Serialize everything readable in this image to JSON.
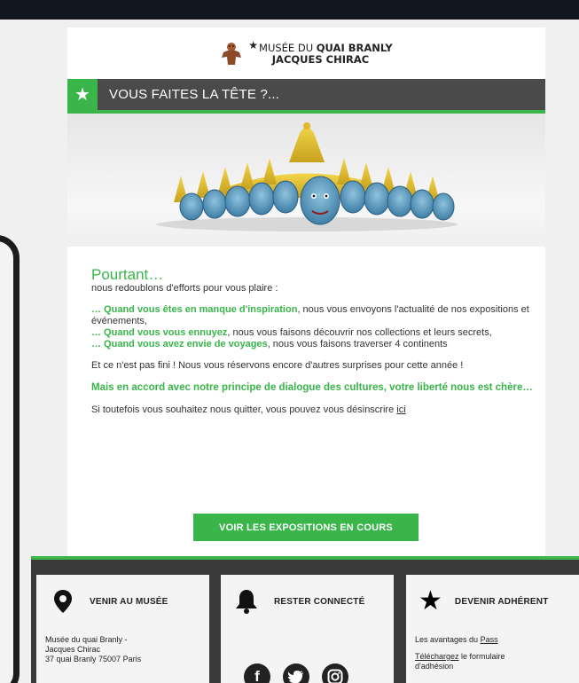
{
  "logo": {
    "star": "★",
    "line1_prefix": "MUSÉE DU",
    "line1_bold": "QUAI BRANLY",
    "line2": "JACQUES CHIRAC"
  },
  "banner": {
    "star": "★",
    "title": "VOUS FAITES LA TÊTE ?..."
  },
  "content": {
    "heading": "Pourtant…",
    "intro": "nous redoublons d'efforts pour vous plaire :",
    "items": [
      {
        "green": "… Quand vous êtes en manque d'inspiration",
        "rest": ", nous vous envoyons l'actualité de nos expositions et événements,"
      },
      {
        "green": "… Quand vous vous ennuyez",
        "rest": ", nous vous faisons découvrir nos collections et leurs secrets,"
      },
      {
        "green": "… Quand vous avez envie de voyages",
        "rest": ", nous vous faisons traverser 4 continents"
      }
    ],
    "surprise": "Et ce n'est pas fini ! Nous vous réservons encore d'autres surprises pour cette année !",
    "freedom": "Mais en accord avec notre principe de dialogue des cultures, votre liberté nous est chère…",
    "unsubscribe_text": "Si toutefois vous souhaitez nous quitter, vous pouvez vous désinscrire",
    "unsubscribe_link": "ici"
  },
  "cta": {
    "label": "VOIR LES EXPOSITIONS EN COURS"
  },
  "footer": {
    "visit": {
      "title": "VENIR AU MUSÉE",
      "address": [
        "Musée du quai Branly -",
        "Jacques Chirac",
        "37 quai Branly 75007 Paris"
      ]
    },
    "connect": {
      "title": "RESTER CONNECTÉ",
      "icons": [
        "facebook-icon",
        "twitter-icon",
        "instagram-icon"
      ]
    },
    "member": {
      "title": "DEVENIR ADHÉRENT",
      "line1_prefix": "Les avantages du",
      "line1_link": "Pass",
      "line2_link": "Téléchargez",
      "line2_rest": "le formulaire",
      "line3": "d'adhésion"
    }
  },
  "colors": {
    "accent": "#39b54a",
    "banner": "#4a4a4a",
    "footer": "#3a3a3a"
  }
}
